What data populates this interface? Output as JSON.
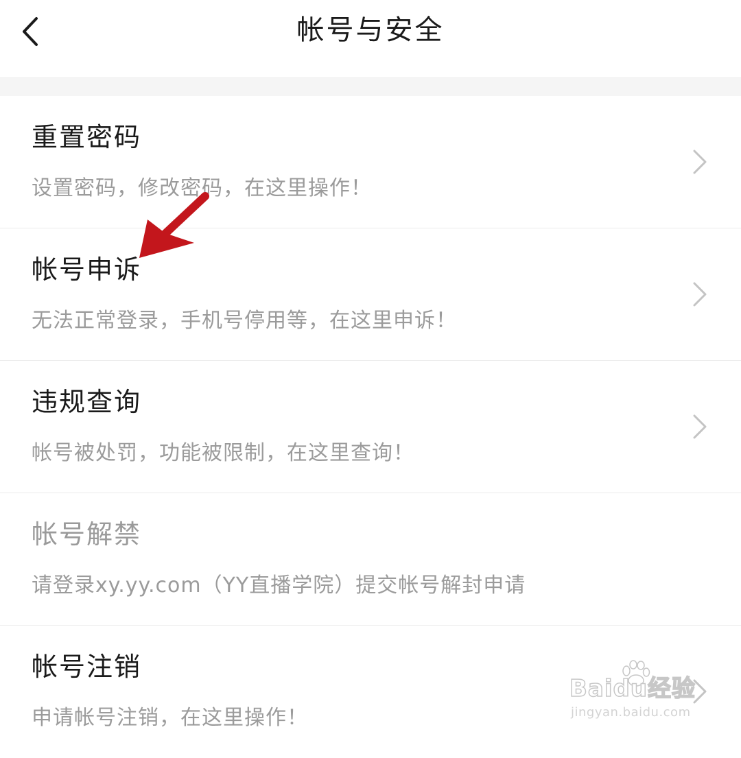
{
  "header": {
    "title": "帐号与安全",
    "back_icon": "chevron-left-icon"
  },
  "colors": {
    "title_text": "#1a1a1a",
    "desc_text": "#9b9b9b",
    "disabled_text": "#9a9a9a",
    "divider": "#ececec",
    "section_bg": "#f5f5f5",
    "chevron": "#c4c4c4",
    "annotation_arrow": "#c3161c"
  },
  "items": [
    {
      "title": "重置密码",
      "desc": "设置密码，修改密码，在这里操作！",
      "has_chevron": true
    },
    {
      "title": "帐号申诉",
      "desc": "无法正常登录，手机号停用等，在这里申诉！",
      "has_chevron": true
    },
    {
      "title": "违规查询",
      "desc": "帐号被处罚，功能被限制，在这里查询！",
      "has_chevron": true
    },
    {
      "title": "帐号解禁",
      "desc": "请登录xy.yy.com（YY直播学院）提交帐号解封申请",
      "has_chevron": false
    },
    {
      "title": "帐号注销",
      "desc": "申请帐号注销，在这里操作！",
      "has_chevron": true
    }
  ],
  "watermark": {
    "brand": "Baidu经验",
    "url": "jingyan.baidu.com"
  }
}
